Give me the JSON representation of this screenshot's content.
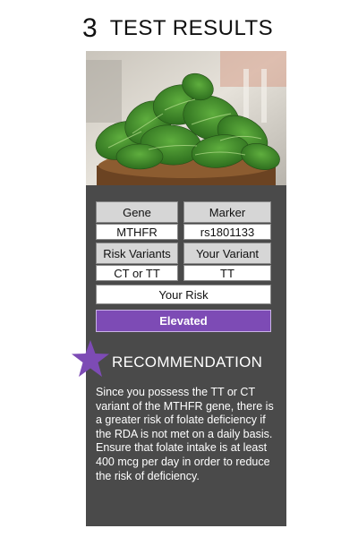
{
  "header": {
    "number": "3",
    "title": "TEST RESULTS"
  },
  "table": {
    "gene_label": "Gene",
    "marker_label": "Marker",
    "gene_value": "MTHFR",
    "marker_value": "rs1801133",
    "risk_variants_label": "Risk Variants",
    "your_variant_label": "Your Variant",
    "risk_variants_value": "CT or TT",
    "your_variant_value": "TT",
    "your_risk_label": "Your Risk",
    "your_risk_value": "Elevated"
  },
  "recommendation": {
    "title": "RECOMMENDATION",
    "body": "Since you possess the TT or CT variant of the MTHFR gene, there is a greater risk of folate deficiency if the RDA is not met on a daily basis. Ensure that folate intake is at least 400 mcg per day in order to reduce the risk of deficiency."
  },
  "colors": {
    "card_background": "#4a4a4a",
    "accent_purple": "#7d4bb5",
    "header_cell": "#d6d6d6"
  },
  "icons": {
    "recommendation_icon": "star-icon",
    "photo": "spinach-bowl-image"
  }
}
